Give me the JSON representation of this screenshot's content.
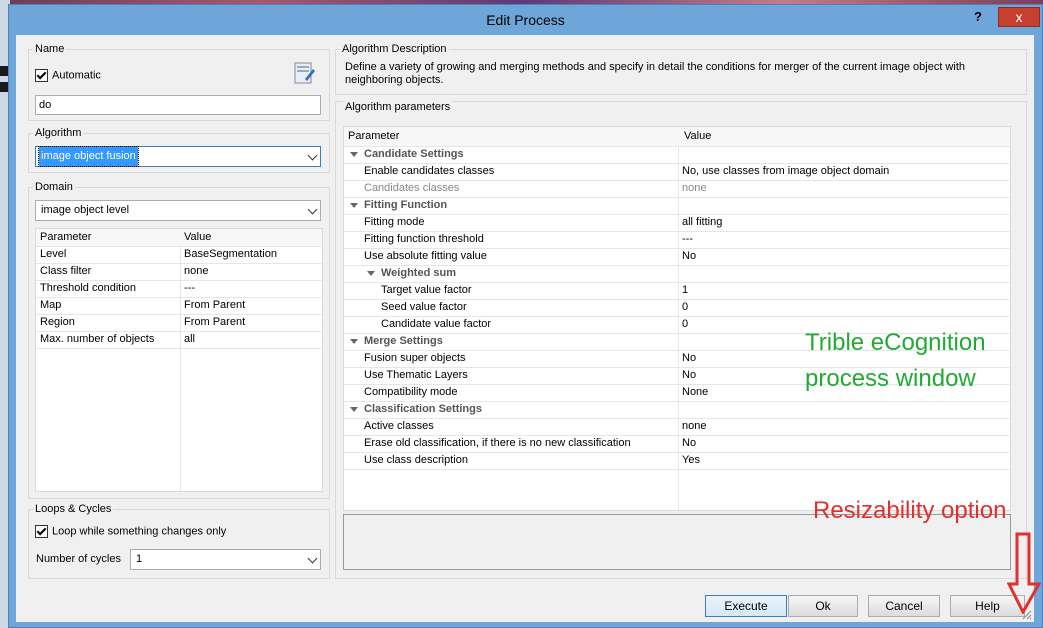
{
  "window": {
    "title": "Edit Process",
    "help_glyph": "?",
    "close_glyph": "x"
  },
  "name_section": {
    "legend": "Name",
    "automatic_label": "Automatic",
    "automatic_checked": true,
    "name_value": "do",
    "icon": "edit-name-icon"
  },
  "algorithm_section": {
    "legend": "Algorithm",
    "selected": "image object fusion"
  },
  "domain_section": {
    "legend": "Domain",
    "selected": "image object level",
    "columns": [
      "Parameter",
      "Value"
    ],
    "rows": [
      {
        "param": "Level",
        "value": "BaseSegmentation"
      },
      {
        "param": "Class filter",
        "value": "none"
      },
      {
        "param": "Threshold condition",
        "value": "---"
      },
      {
        "param": "Map",
        "value": "From Parent"
      },
      {
        "param": "Region",
        "value": "From Parent"
      },
      {
        "param": "Max. number of objects",
        "value": "all"
      }
    ]
  },
  "loops_section": {
    "legend": "Loops & Cycles",
    "loop_label": "Loop while something changes only",
    "loop_checked": true,
    "cycles_label": "Number of cycles",
    "cycles_value": "1"
  },
  "description_section": {
    "legend": "Algorithm Description",
    "text": "Define a variety of growing and merging methods and specify in detail the conditions for merger of the current image object with neighboring objects."
  },
  "parameters_section": {
    "legend": "Algorithm parameters",
    "columns": [
      "Parameter",
      "Value"
    ],
    "rows": [
      {
        "kind": "group",
        "level": 0,
        "param": "Candidate Settings",
        "value": ""
      },
      {
        "kind": "item",
        "level": 0,
        "param": "Enable candidates classes",
        "value": "No, use classes from image object domain"
      },
      {
        "kind": "disabled",
        "level": 0,
        "param": "Candidates classes",
        "value": "none"
      },
      {
        "kind": "group",
        "level": 0,
        "param": "Fitting Function",
        "value": ""
      },
      {
        "kind": "item",
        "level": 0,
        "param": "Fitting mode",
        "value": "all fitting"
      },
      {
        "kind": "item",
        "level": 0,
        "param": "Fitting function threshold",
        "value": "---"
      },
      {
        "kind": "item",
        "level": 0,
        "param": "Use absolute fitting value",
        "value": "No"
      },
      {
        "kind": "group",
        "level": 1,
        "param": "Weighted sum",
        "value": ""
      },
      {
        "kind": "item",
        "level": 1,
        "param": "Target value factor",
        "value": "1"
      },
      {
        "kind": "item",
        "level": 1,
        "param": "Seed value factor",
        "value": "0"
      },
      {
        "kind": "item",
        "level": 1,
        "param": "Candidate value factor",
        "value": "0"
      },
      {
        "kind": "group",
        "level": 0,
        "param": "Merge Settings",
        "value": ""
      },
      {
        "kind": "item",
        "level": 0,
        "param": "Fusion super objects",
        "value": "No"
      },
      {
        "kind": "item",
        "level": 0,
        "param": "Use Thematic Layers",
        "value": "No"
      },
      {
        "kind": "item",
        "level": 0,
        "param": "Compatibility mode",
        "value": "None"
      },
      {
        "kind": "group",
        "level": 0,
        "param": "Classification Settings",
        "value": ""
      },
      {
        "kind": "item",
        "level": 0,
        "param": "Active classes",
        "value": "none"
      },
      {
        "kind": "item",
        "level": 0,
        "param": "Erase old classification, if there is no new classification",
        "value": "No"
      },
      {
        "kind": "item",
        "level": 0,
        "param": "Use class description",
        "value": "Yes"
      }
    ]
  },
  "buttons": {
    "execute": "Execute",
    "ok": "Ok",
    "cancel": "Cancel",
    "help": "Help"
  },
  "annotations": {
    "green_line1": "Trible eCognition",
    "green_line2": "process window",
    "red": "Resizability option",
    "green_color": "#22aa33",
    "red_color": "#e03030"
  },
  "colors": {
    "titlebar": "#6fa6d9",
    "close": "#c7402f",
    "selection": "#3399ff"
  }
}
